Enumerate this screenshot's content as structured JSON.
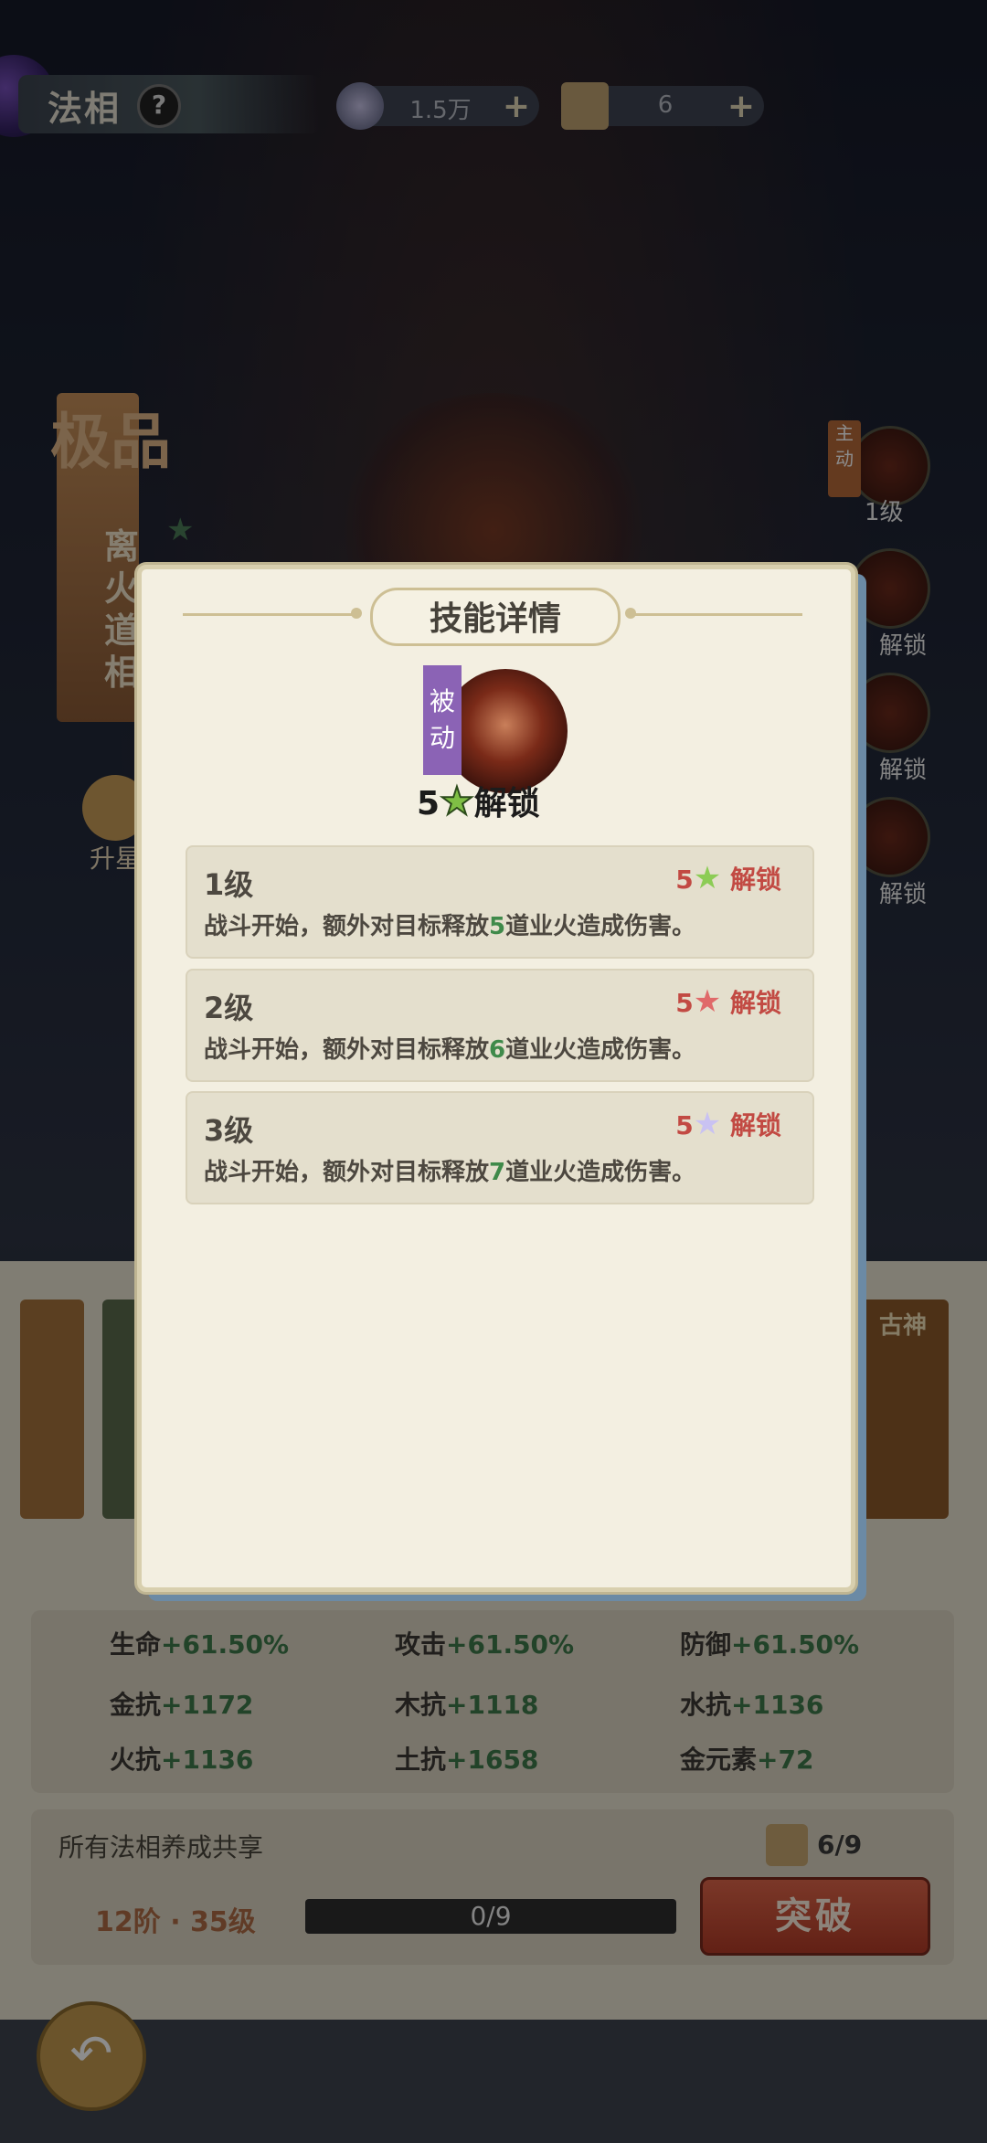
{
  "topbar": {
    "title": "法相",
    "help_icon": "question-icon",
    "resources": [
      {
        "icon": "spirit-coin-icon",
        "value": "1.5万",
        "plus": "+"
      },
      {
        "icon": "scroll-icon",
        "value": "6",
        "plus": "+"
      }
    ]
  },
  "background": {
    "grade": "极品",
    "hero_name": "离火道相",
    "upgrade_star_label": "升星",
    "skills": [
      {
        "tag": "主动",
        "label": "1级"
      },
      {
        "label": "解锁"
      },
      {
        "label": "解锁"
      },
      {
        "label": "解锁"
      }
    ],
    "card_right_tag": "古神",
    "stats": [
      {
        "label": "生命",
        "value": "+61.50%"
      },
      {
        "label": "攻击",
        "value": "+61.50%"
      },
      {
        "label": "防御",
        "value": "+61.50%"
      },
      {
        "label": "金抗",
        "value": "+1172"
      },
      {
        "label": "木抗",
        "value": "+1118"
      },
      {
        "label": "水抗",
        "value": "+1136"
      },
      {
        "label": "火抗",
        "value": "+1136"
      },
      {
        "label": "土抗",
        "value": "+1658"
      },
      {
        "label": "金元素",
        "value": "+72"
      }
    ],
    "share_title": "所有法相养成共享",
    "share_count": "6/9",
    "level_text": "12阶 · 35级",
    "progress_text": "0/9",
    "progress_fraction": 0.0,
    "break_button": "突破"
  },
  "modal": {
    "title": "技能详情",
    "passive_tag": "被动",
    "unlock_stars": "5",
    "unlock_text": "解锁",
    "levels": [
      {
        "title": "1级",
        "stars": "5",
        "star_color": "#8ccc55",
        "unlock": "解锁",
        "desc_pre": "战斗开始，额外对目标释放",
        "desc_num": "5",
        "desc_post": "道业火造成伤害。"
      },
      {
        "title": "2级",
        "stars": "5",
        "star_color": "#e06a6a",
        "unlock": "解锁",
        "desc_pre": "战斗开始，额外对目标释放",
        "desc_num": "6",
        "desc_post": "道业火造成伤害。"
      },
      {
        "title": "3级",
        "stars": "5",
        "star_color": "#c9c2f2",
        "unlock": "解锁",
        "desc_pre": "战斗开始，额外对目标释放",
        "desc_num": "7",
        "desc_post": "道业火造成伤害。"
      }
    ]
  }
}
